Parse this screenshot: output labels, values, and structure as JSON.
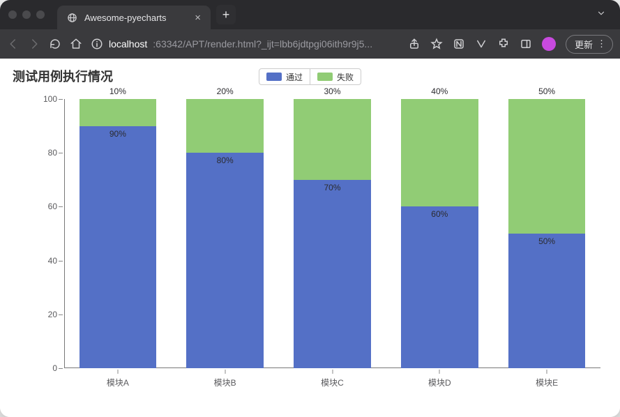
{
  "browser": {
    "tab_title": "Awesome-pyecharts",
    "url_host": "localhost",
    "url_path": ":63342/APT/render.html?_ijt=lbb6jdtpgi06ith9r9j5...",
    "update_label": "更新"
  },
  "chart_data": {
    "type": "bar",
    "stacked": true,
    "title": "测试用例执行情况",
    "categories": [
      "模块A",
      "模块B",
      "模块C",
      "模块D",
      "模块E"
    ],
    "series": [
      {
        "name": "通过",
        "color": "#5470c6",
        "values": [
          90,
          80,
          70,
          60,
          50
        ],
        "label_fmt": "percent_inner"
      },
      {
        "name": "失败",
        "color": "#91cc75",
        "values": [
          10,
          20,
          30,
          40,
          50
        ],
        "label_fmt": "percent_top"
      }
    ],
    "ylim": [
      0,
      100
    ],
    "yticks": [
      0,
      20,
      40,
      60,
      80,
      100
    ],
    "xlabel": "",
    "ylabel": ""
  }
}
